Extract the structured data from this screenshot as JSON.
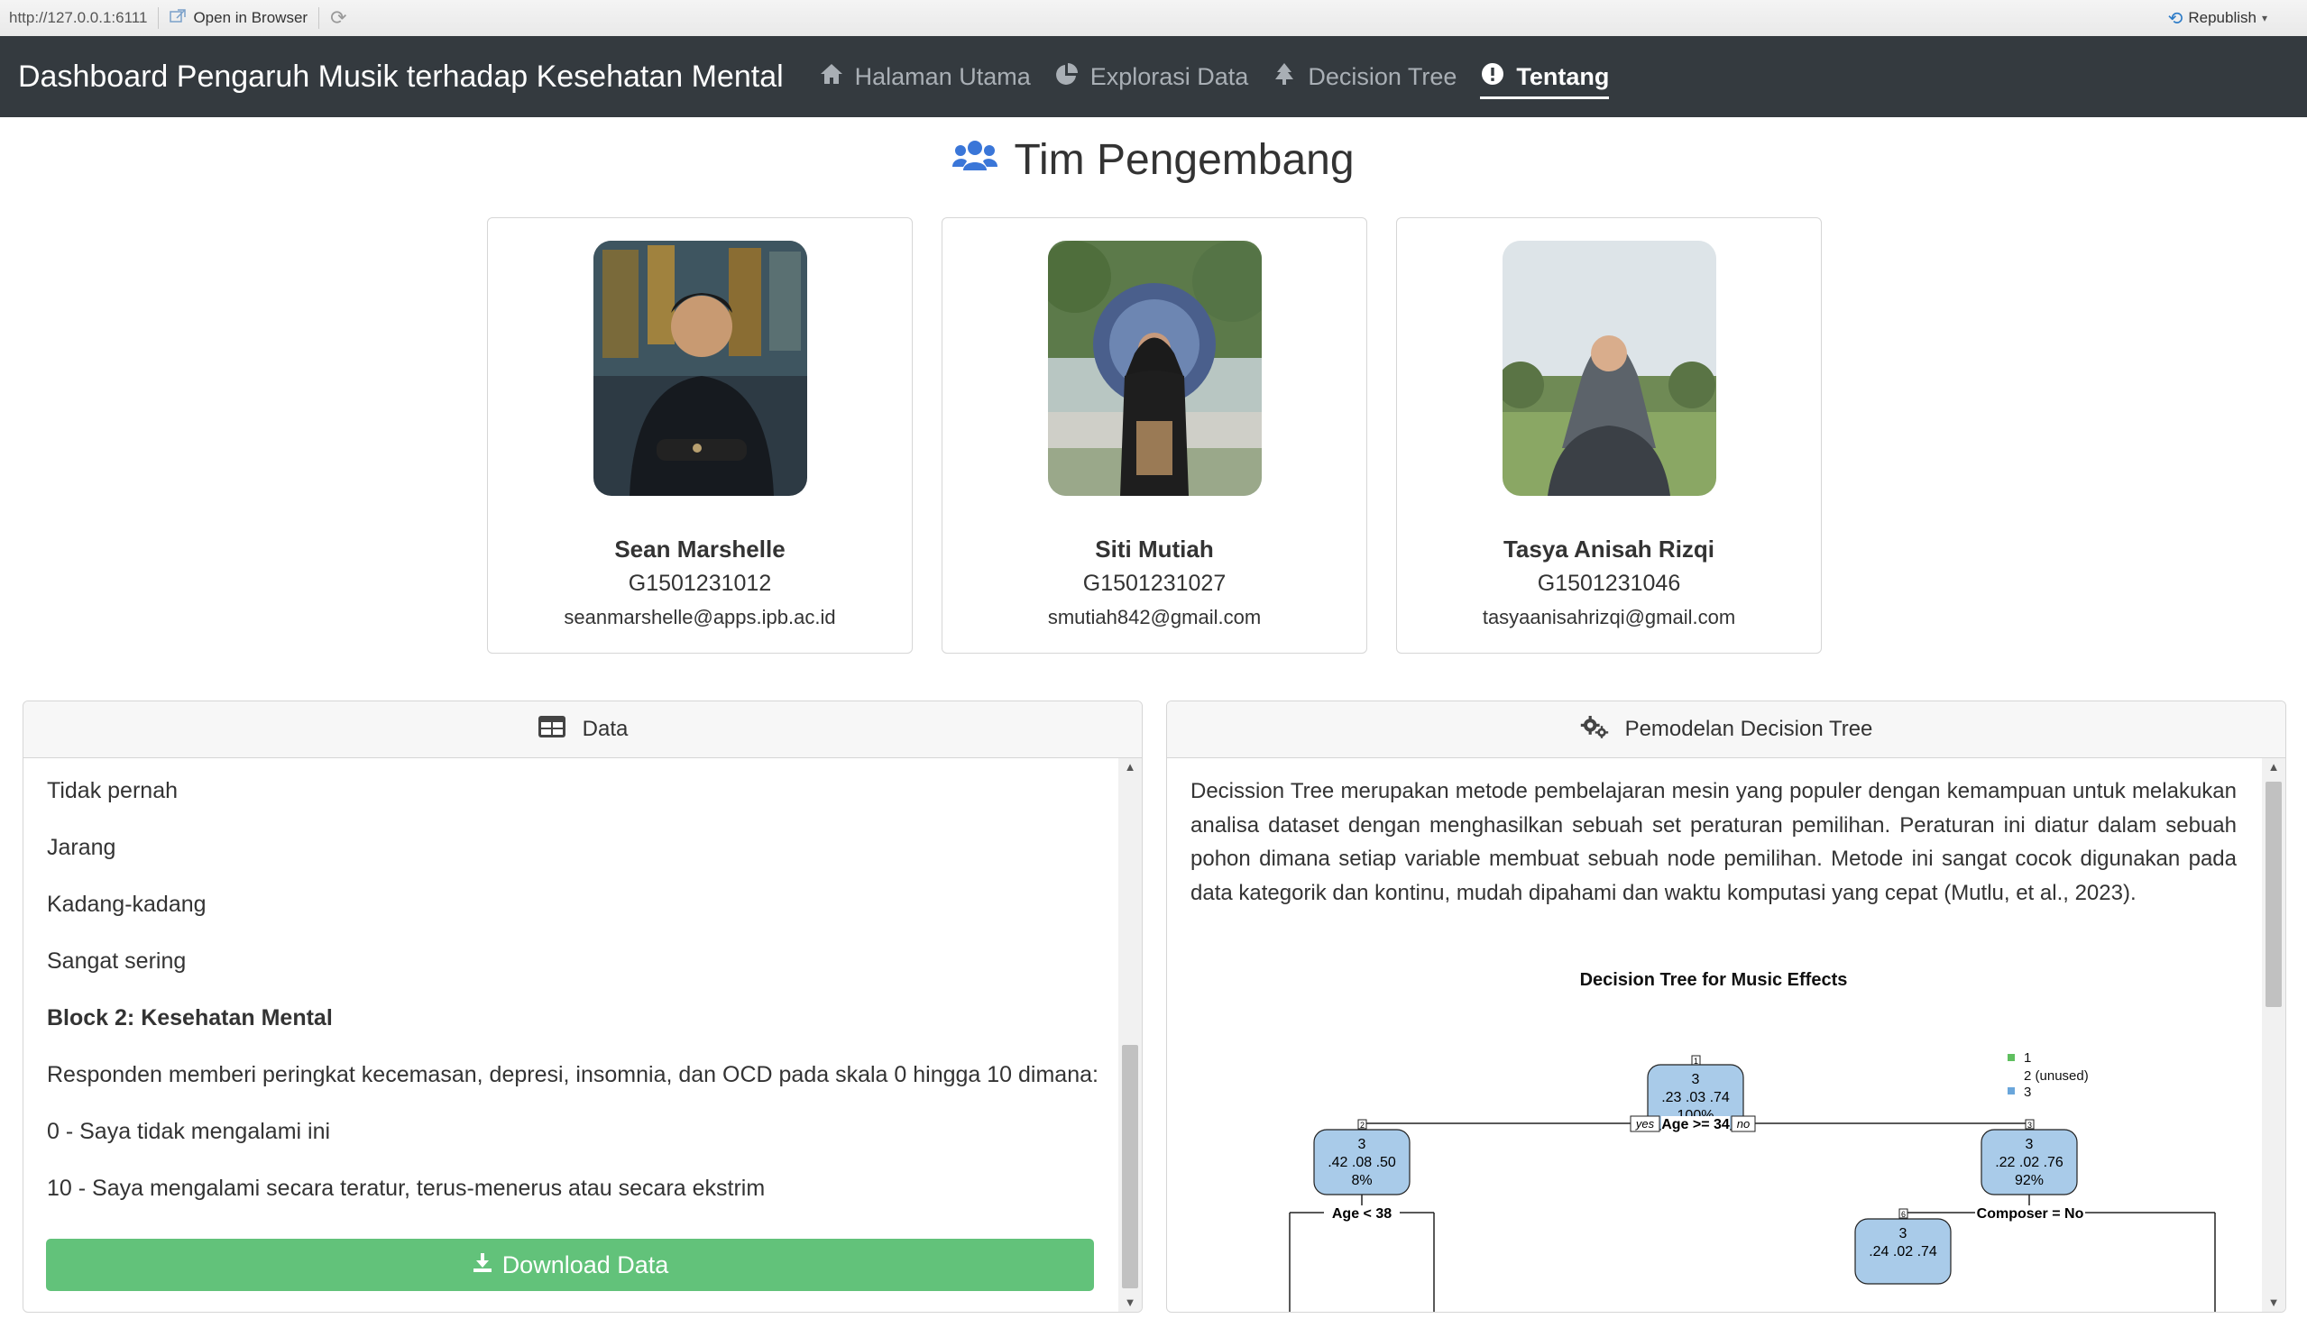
{
  "viewer": {
    "url": "http://127.0.0.1:6111",
    "open_browser": "Open in Browser",
    "republish": "Republish"
  },
  "navbar": {
    "brand": "Dashboard Pengaruh Musik terhadap Kesehatan Mental",
    "items": [
      {
        "label": "Halaman Utama",
        "icon": "home-icon"
      },
      {
        "label": "Explorasi Data",
        "icon": "chart-pie-icon"
      },
      {
        "label": "Decision Tree",
        "icon": "tree-icon"
      },
      {
        "label": "Tentang",
        "icon": "info-circle-icon",
        "active": true
      }
    ]
  },
  "title": "Tim Pengembang",
  "team": [
    {
      "name": "Sean Marshelle",
      "nim": "G1501231012",
      "email": "seanmarshelle@apps.ipb.ac.id"
    },
    {
      "name": "Siti Mutiah",
      "nim": "G1501231027",
      "email": "smutiah842@gmail.com"
    },
    {
      "name": "Tasya Anisah Rizqi",
      "nim": "G1501231046",
      "email": "tasyaanisahrizqi@gmail.com"
    }
  ],
  "data_panel": {
    "header": "Data",
    "lines": [
      "Tidak pernah",
      "Jarang",
      "Kadang-kadang",
      "Sangat sering",
      "Block 2: Kesehatan Mental",
      "Responden memberi peringkat kecemasan, depresi, insomnia, dan OCD pada skala 0 hingga 10 dimana:",
      "0 - Saya tidak mengalami ini",
      "10 - Saya mengalami secara teratur, terus-menerus atau secara ekstrim"
    ],
    "download_label": "Download Data"
  },
  "model_panel": {
    "header": "Pemodelan Decision Tree",
    "paragraph": "Decission Tree merupakan metode pembelajaran mesin yang populer dengan kemampuan untuk melakukan analisa dataset dengan menghasilkan sebuah set peraturan pemilihan. Peraturan ini diatur dalam sebuah pohon dimana setiap variable membuat sebuah node pemilihan. Metode ini sangat cocok digunakan pada data kategorik dan kontinu, mudah dipahami dan waktu komputasi yang cepat (Mutlu, et al., 2023).",
    "tree": {
      "title": "Decision Tree for Music Effects",
      "legend": [
        "1",
        "2 (unused)",
        "3"
      ],
      "legend_colors": [
        "#5fbf5f",
        "#999999",
        "#6aa6db"
      ],
      "root": {
        "id": "1",
        "class": "3",
        "probs": ".23 .03 .74",
        "pct": "100%"
      },
      "split1": {
        "label": "Age >= 34",
        "yes": "yes",
        "no": "no"
      },
      "left": {
        "id": "2",
        "class": "3",
        "probs": ".42 .08 .50",
        "pct": "8%"
      },
      "right": {
        "id": "3",
        "class": "3",
        "probs": ".22 .02 .76",
        "pct": "92%"
      },
      "split_left": "Age < 38",
      "split_right": "Composer = No",
      "right_child": {
        "id": "6",
        "class": "3",
        "probs": ".24 .02 .74"
      }
    }
  },
  "colors": {
    "navbar_bg": "#343a3f",
    "accent_blue": "#3a76d8",
    "download_green": "#62c27a",
    "node_blue": "#a9cbe9"
  }
}
